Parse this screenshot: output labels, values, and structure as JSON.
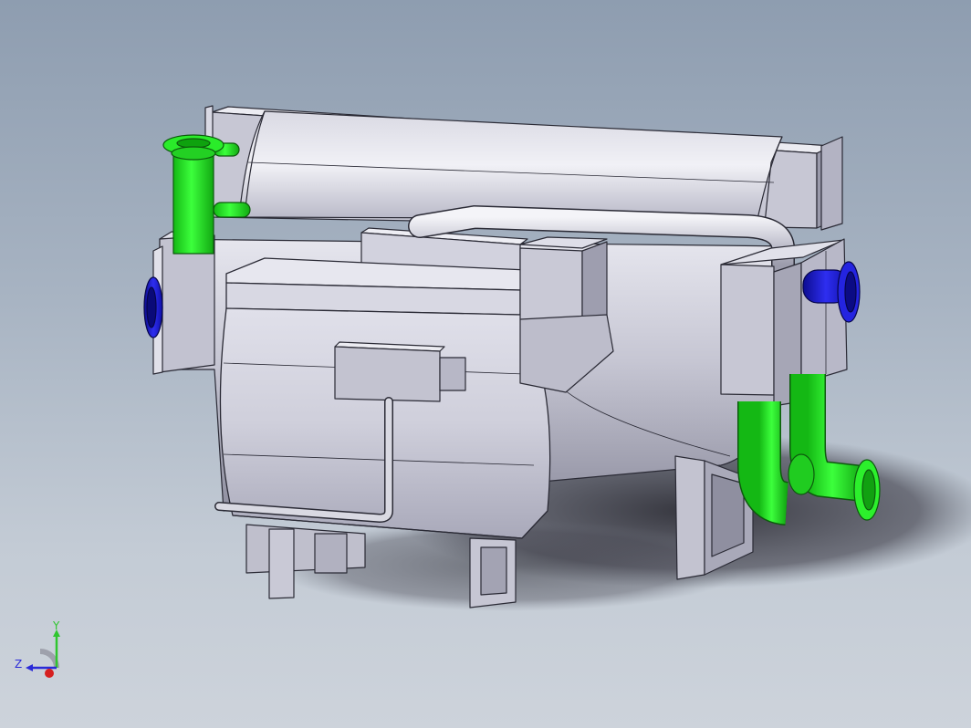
{
  "viewport": {
    "background_top": "#8e9db0",
    "background_bottom": "#cdd3db"
  },
  "model": {
    "body_color": "#c9c9d6",
    "edge_color": "#2a2a35",
    "green_pipe_color": "#22e022",
    "blue_flange_color": "#1d1dd6",
    "shadow_color": "#3c3c44"
  },
  "triad": {
    "y_label": "Y",
    "z_label": "Z",
    "y_color": "#2fc62f",
    "z_color": "#2b2bd8",
    "x_color": "#d62020"
  }
}
